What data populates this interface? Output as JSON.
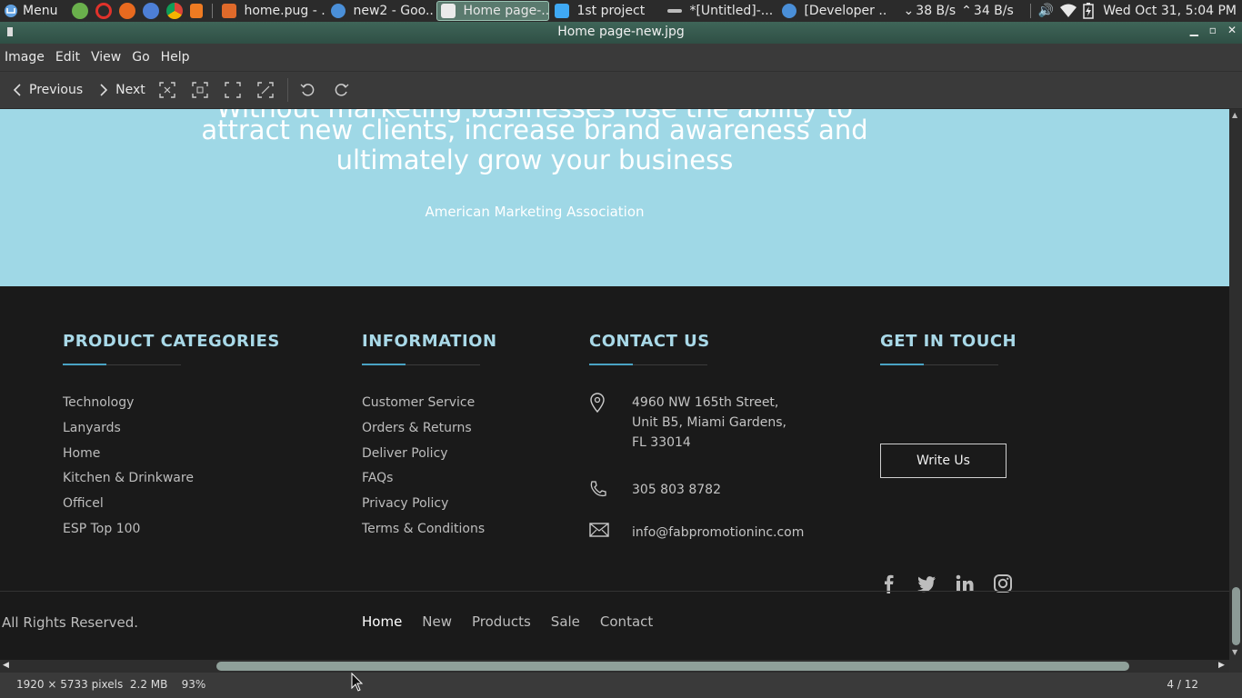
{
  "panel": {
    "menu_label": "Menu",
    "tasks": [
      {
        "label": "home.pug - ...",
        "icon": "vscode-icon",
        "color": "#e06a2a"
      },
      {
        "label": "new2 - Goo...",
        "icon": "chrome-icon",
        "color": "#4a8fd8"
      },
      {
        "label": "Home page-...",
        "icon": "image-viewer-icon",
        "color": "#ffffff",
        "active": true
      },
      {
        "label": "1st project",
        "icon": "folder-icon",
        "color": "#3fa9f5"
      },
      {
        "label": "*[Untitled]-...",
        "icon": "editor-icon",
        "color": "#dddddd"
      },
      {
        "label": "[Developer ...",
        "icon": "chrome-icon",
        "color": "#4a8fd8"
      }
    ],
    "net_down": "38 B/s",
    "net_up": "34 B/s",
    "clock": "Wed Oct 31,  5:04 PM"
  },
  "window": {
    "title": "Home page-new.jpg"
  },
  "menubar": [
    "Image",
    "Edit",
    "View",
    "Go",
    "Help"
  ],
  "toolbar": {
    "previous": "Previous",
    "next": "Next"
  },
  "hero": {
    "line_cut": "Without marketing businesses lose the ability to",
    "line1": "attract new clients, increase brand awareness and",
    "line2": "ultimately grow your business",
    "attribution": "American Marketing Association"
  },
  "footer": {
    "categories": {
      "title": "PRODUCT CATEGORIES",
      "items": [
        "Technology",
        "Lanyards",
        "Home",
        "Kitchen & Drinkware",
        "Officel",
        "ESP Top 100"
      ]
    },
    "information": {
      "title": "INFORMATION",
      "items": [
        "Customer Service",
        "Orders & Returns",
        "Deliver Policy",
        "FAQs",
        "Privacy Policy",
        "Terms & Conditions"
      ]
    },
    "contact": {
      "title": "CONTACT US",
      "address_line1": "4960 NW 165th Street,",
      "address_line2": "Unit B5, Miami Gardens,",
      "address_line3": "FL 33014",
      "phone": "305 803 8782",
      "email": "info@fabpromotioninc.com"
    },
    "touch": {
      "title": "GET IN TOUCH",
      "button": "Write Us",
      "social": [
        "facebook-icon",
        "twitter-icon",
        "linkedin-icon",
        "instagram-icon"
      ]
    },
    "copyright": "All Rights Reserved.",
    "nav": [
      "Home",
      "New",
      "Products",
      "Sale",
      "Contact"
    ]
  },
  "status": {
    "dimensions": "1920 × 5733 pixels",
    "size": "2.2 MB",
    "zoom": "93%",
    "position": "4 / 12"
  },
  "colors": {
    "hero_bg": "#9fd8e6",
    "footer_bg": "#1a1a1a",
    "heading": "#a9d9e8",
    "accent": "#4aa3c4"
  }
}
